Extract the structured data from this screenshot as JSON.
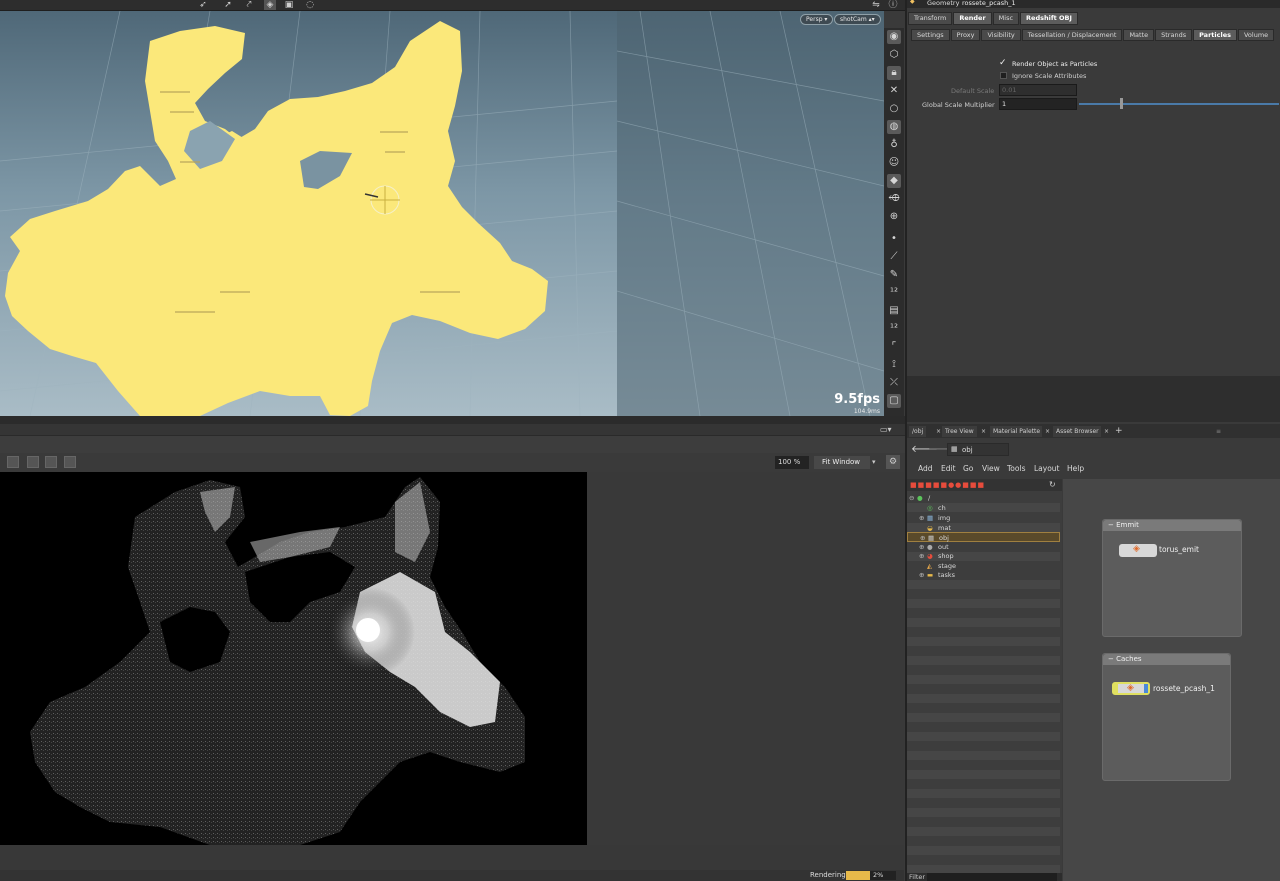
{
  "parm_header": {
    "type": "Geometry",
    "node_name": "rossete_pcash_1"
  },
  "parm_tabs": [
    "Transform",
    "Render",
    "Misc",
    "Redshift OBJ"
  ],
  "parm_subtabs": [
    "Settings",
    "Proxy",
    "Visibility",
    "Tessellation / Displacement",
    "Matte",
    "Strands",
    "Particles",
    "Volume"
  ],
  "parms": {
    "render_as_particles": {
      "label": "Render Object as Particles",
      "checked": true
    },
    "ignore_scale": {
      "label": "Ignore Scale Attributes",
      "checked": false
    },
    "default_scale": {
      "label": "Default Scale",
      "value": "0.01"
    },
    "global_scale": {
      "label": "Global Scale Multiplier",
      "value": "1"
    }
  },
  "viewport": {
    "persp_label": "Persp",
    "cam_label": "shotCam",
    "fps": "9.5fps",
    "ms": "104.9ms"
  },
  "render_view": {
    "zoom": "100 %",
    "fit_label": "Fit Window",
    "status": "Rendering",
    "progress_pct": "2%"
  },
  "net_tabs": [
    "/obj",
    "Tree View",
    "Material Palette",
    "Asset Browser"
  ],
  "net_path": "obj",
  "net_menu": [
    "Add",
    "Edit",
    "Go",
    "View",
    "Tools",
    "Layout",
    "Help"
  ],
  "tree": [
    {
      "label": "/",
      "indent": 0
    },
    {
      "label": "ch",
      "indent": 1
    },
    {
      "label": "img",
      "indent": 1
    },
    {
      "label": "mat",
      "indent": 1
    },
    {
      "label": "obj",
      "indent": 1,
      "selected": true
    },
    {
      "label": "out",
      "indent": 1
    },
    {
      "label": "shop",
      "indent": 1
    },
    {
      "label": "stage",
      "indent": 1
    },
    {
      "label": "tasks",
      "indent": 1
    }
  ],
  "network_boxes": [
    {
      "title": "Emmit",
      "node": "torus_emit"
    },
    {
      "title": "Caches",
      "node": "rossete_pcash_1"
    }
  ],
  "filter_label": "Filter",
  "colors": {
    "point_cloud": "#fbe87a",
    "accent": "#e7b94a",
    "selected_row": "#5a4a2a"
  }
}
